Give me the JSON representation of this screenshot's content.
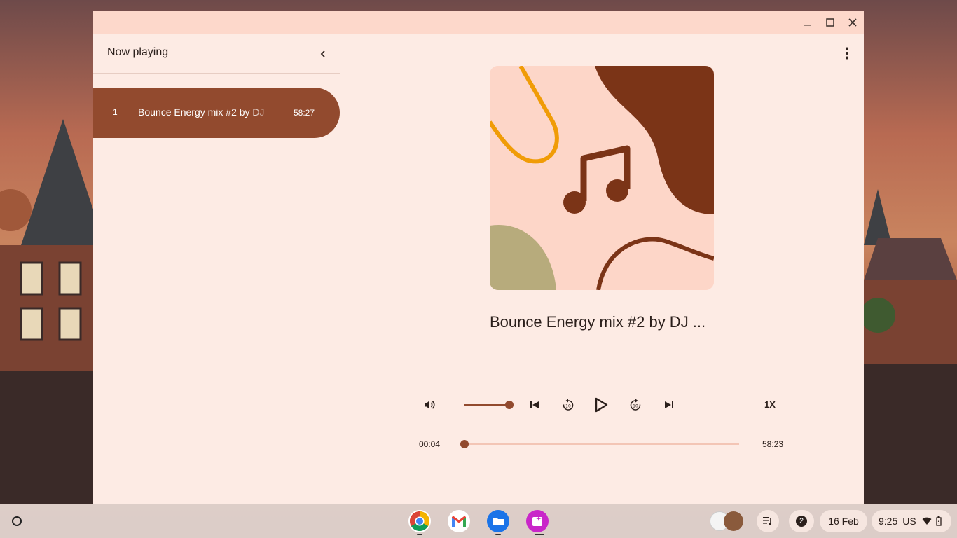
{
  "window": {
    "minimize_icon": "minimize-icon",
    "maximize_icon": "maximize-icon",
    "close_icon": "close-icon"
  },
  "sidebar": {
    "title": "Now playing",
    "collapse_icon": "chevron-left-icon",
    "tracks": [
      {
        "number": "1",
        "title": "Bounce Energy mix #2 by DJ",
        "duration": "58:27"
      }
    ]
  },
  "player": {
    "title": "Bounce Energy mix #2 by DJ ...",
    "volume_level": 1.0,
    "speed": "1X",
    "current_time": "00:04",
    "total_time": "58:23",
    "progress": 0.001,
    "icons": [
      "volume-icon",
      "skip-previous-icon",
      "replay-10-icon",
      "play-icon",
      "forward-10-icon",
      "skip-next-icon",
      "more-vert-icon"
    ]
  },
  "shelf": {
    "apps": [
      "Chrome",
      "Gmail",
      "Files",
      "Gallery"
    ],
    "notification_count": "2",
    "date": "16 Feb",
    "time": "9:25",
    "locale": "US"
  },
  "colors": {
    "accent": "#924a2e",
    "window_bg": "#fdebe4",
    "titlebar_bg": "#fdd8cb"
  }
}
